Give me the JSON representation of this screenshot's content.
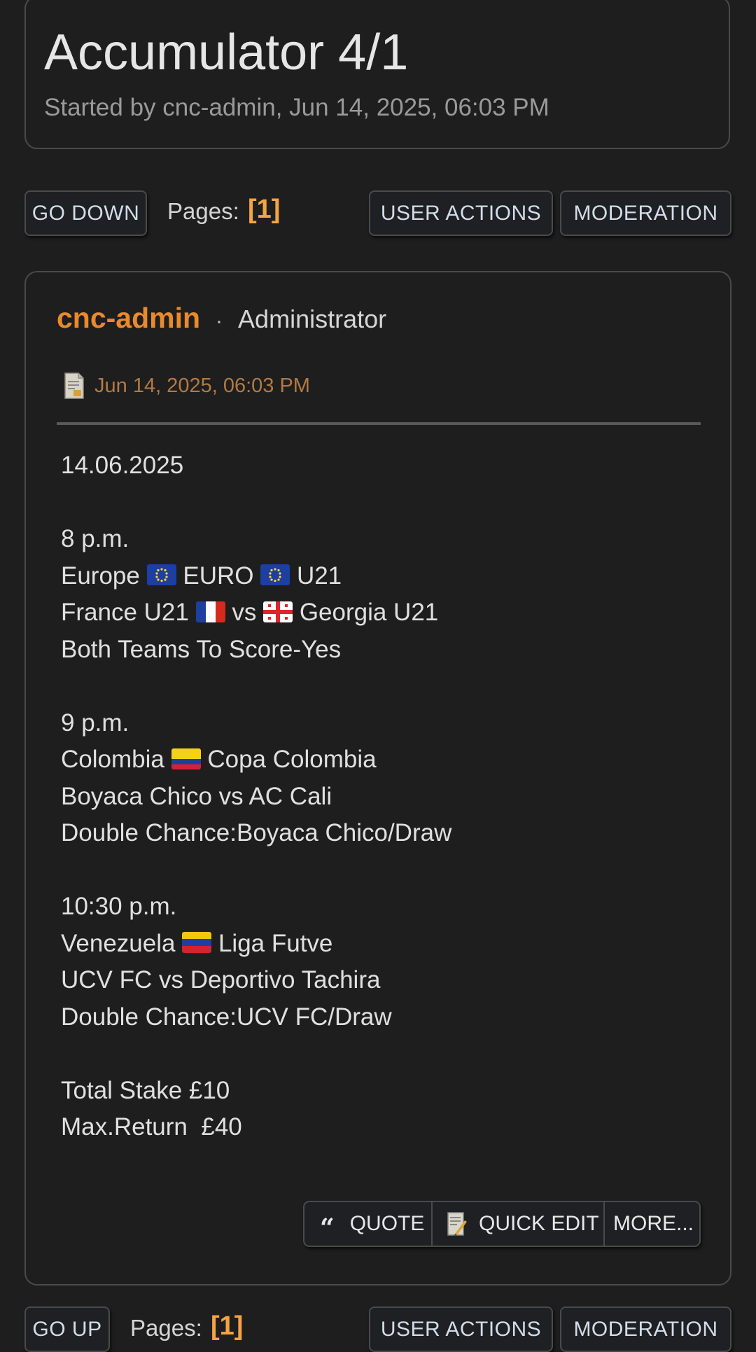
{
  "topic": {
    "title": "Accumulator 4/1",
    "started_by": "Started by cnc-admin, Jun 14, 2025, 06:03 PM"
  },
  "nav_top": {
    "go_label": "GO DOWN",
    "pages_label": "Pages:",
    "pages_value": "[1]",
    "user_actions": "USER ACTIONS",
    "moderation": "MODERATION"
  },
  "nav_bottom": {
    "go_label": "GO UP",
    "pages_label": "Pages:",
    "pages_value": "[1]",
    "user_actions": "USER ACTIONS",
    "moderation": "MODERATION"
  },
  "post": {
    "author": "cnc-admin",
    "separator": "·",
    "role": "Administrator",
    "date": "Jun 14, 2025, 06:03 PM",
    "lines": {
      "l1": "14.06.2025",
      "l3": "8 p.m.",
      "l4a": "Europe",
      "l4b": "EURO",
      "l4c": "U21",
      "l5a": "France U21",
      "l5b": "vs",
      "l5c": "Georgia U21",
      "l6": "Both Teams To Score-Yes",
      "l8": "9 p.m.",
      "l9a": "Colombia",
      "l9b": "Copa Colombia",
      "l10": "Boyaca Chico vs AC Cali",
      "l11": "Double Chance:Boyaca Chico/Draw",
      "l13": "10:30 p.m.",
      "l14a": "Venezuela",
      "l14b": "Liga Futve",
      "l15": "UCV FC vs Deportivo Tachira",
      "l16": "Double Chance:UCV FC/Draw",
      "l18": "Total Stake £10",
      "l19": "Max.Return  £40"
    },
    "actions": {
      "quote": "QUOTE",
      "quick_edit": "QUICK EDIT",
      "more": "MORE..."
    }
  },
  "colors": {
    "background": "#1e1e1f",
    "author": "#e98a2c",
    "pages_number": "#f3a444",
    "date": "#b27a42",
    "button_text": "#d3dcea"
  },
  "icons": [
    "document-icon",
    "quote-icon",
    "edit-note-icon",
    "eu-flag-icon",
    "france-flag-icon",
    "georgia-flag-icon",
    "colombia-flag-icon",
    "venezuela-flag-icon"
  ]
}
